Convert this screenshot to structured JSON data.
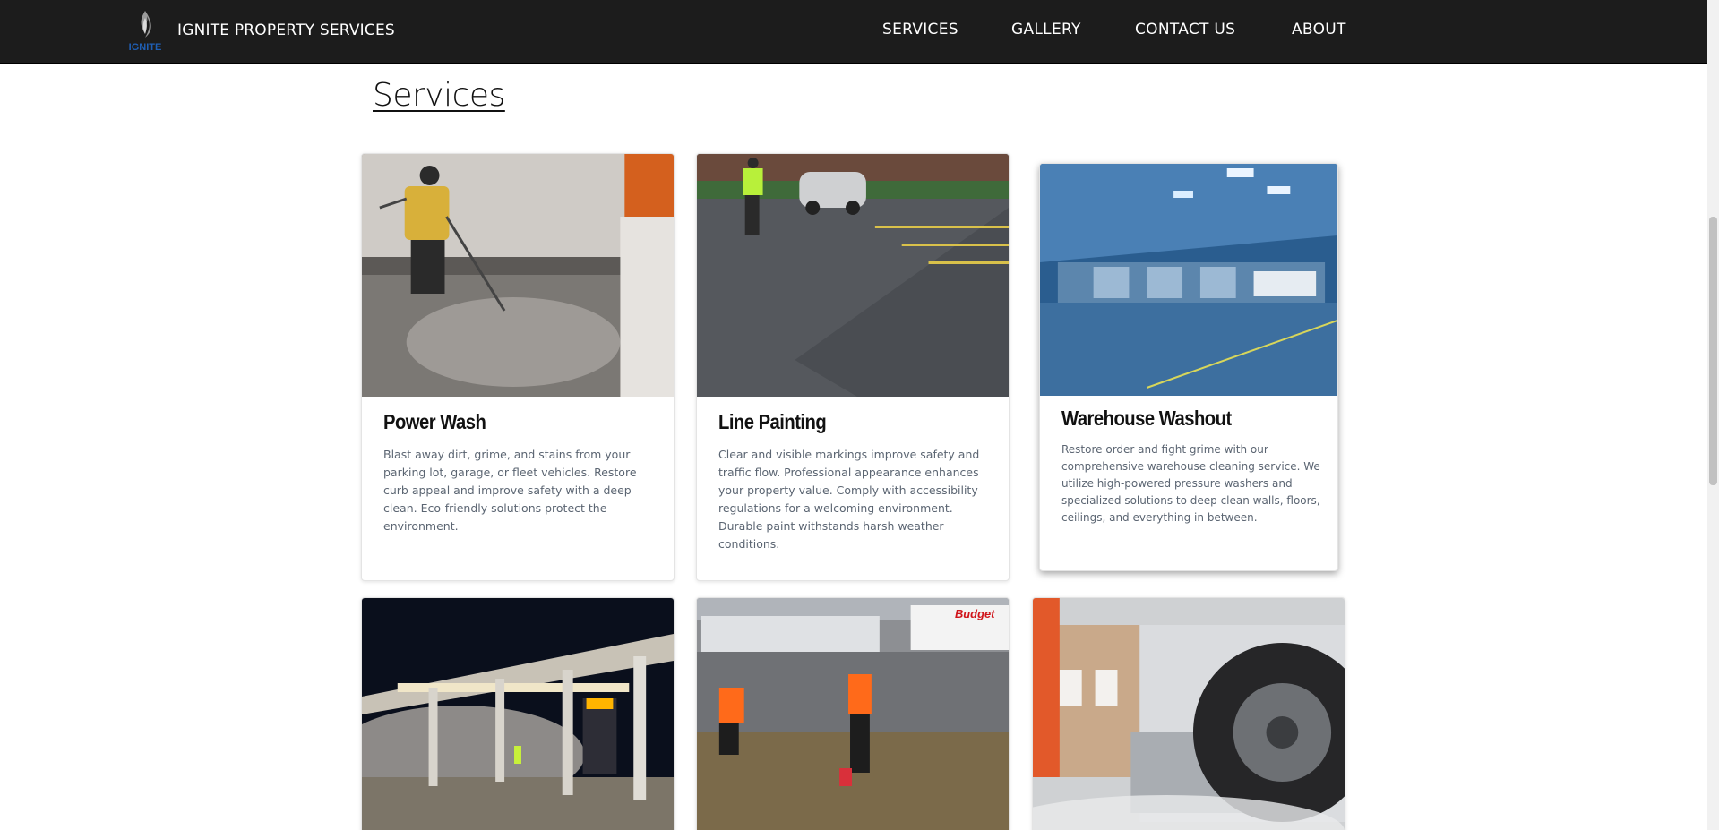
{
  "header": {
    "brand": "IGNITE PROPERTY SERVICES",
    "logo_text": "IGNITE",
    "nav": [
      "SERVICES",
      "GALLERY",
      "CONTACT US",
      "ABOUT"
    ]
  },
  "page": {
    "title": "Services"
  },
  "cards": [
    {
      "title": "Power Wash",
      "text": "Blast away dirt, grime, and stains from your parking lot, garage, or fleet vehicles. Restore curb appeal and improve safety with a deep clean. Eco-friendly solutions protect the environment."
    },
    {
      "title": "Line Painting",
      "text": "Clear and visible markings improve safety and traffic flow. Professional appearance enhances your property value. Comply with accessibility regulations for a welcoming environment. Durable paint withstands harsh weather conditions."
    },
    {
      "title": "Warehouse Washout",
      "text": "Restore order and fight grime with our comprehensive warehouse cleaning service. We utilize high-powered pressure washers and specialized solutions to deep clean walls, floors, ceilings, and everything in between."
    }
  ],
  "image_texts": {
    "budget_sign": "Budget"
  },
  "colors": {
    "header_bg": "#1c1c1c",
    "title_text": "#111111",
    "body_text": "#5b6572",
    "logo_blue": "#1f5fb5"
  }
}
